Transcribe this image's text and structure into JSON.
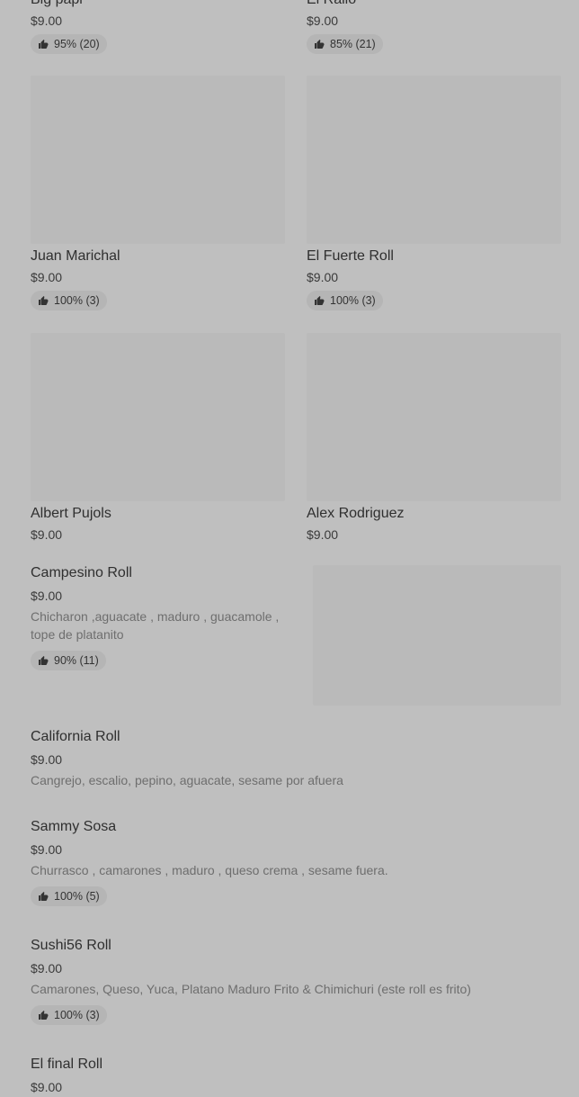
{
  "grid_items": [
    {
      "title": "Big papi",
      "price": "$9.00",
      "rating": "95% (20)"
    },
    {
      "title": "El Rallo",
      "price": "$9.00",
      "rating": "85% (21)"
    },
    {
      "title": "Juan Marichal",
      "price": "$9.00",
      "rating": "100% (3)"
    },
    {
      "title": "El Fuerte Roll",
      "price": "$9.00",
      "rating": "100% (3)"
    },
    {
      "title": "Albert Pujols",
      "price": "$9.00"
    },
    {
      "title": "Alex Rodriguez",
      "price": "$9.00"
    }
  ],
  "list_items": [
    {
      "title": "Campesino Roll",
      "price": "$9.00",
      "description": "Chicharon ,aguacate , maduro , guacamole , tope de platanito",
      "rating": "90% (11)"
    },
    {
      "title": "California Roll",
      "price": "$9.00",
      "description": "Cangrejo, escalio, pepino, aguacate, sesame por afuera"
    },
    {
      "title": "Sammy Sosa",
      "price": "$9.00",
      "description": "Churrasco , camarones , maduro , queso crema , sesame fuera.",
      "rating": "100% (5)"
    },
    {
      "title": "Sushi56 Roll",
      "price": "$9.00",
      "description": "Camarones, Queso, Yuca, Platano Maduro Frito & Chimichuri (este roll es frito)",
      "rating": "100% (3)"
    },
    {
      "title": "El final Roll",
      "price": "$9.00"
    }
  ],
  "icons": {
    "rating": "thumbs-up-icon"
  }
}
